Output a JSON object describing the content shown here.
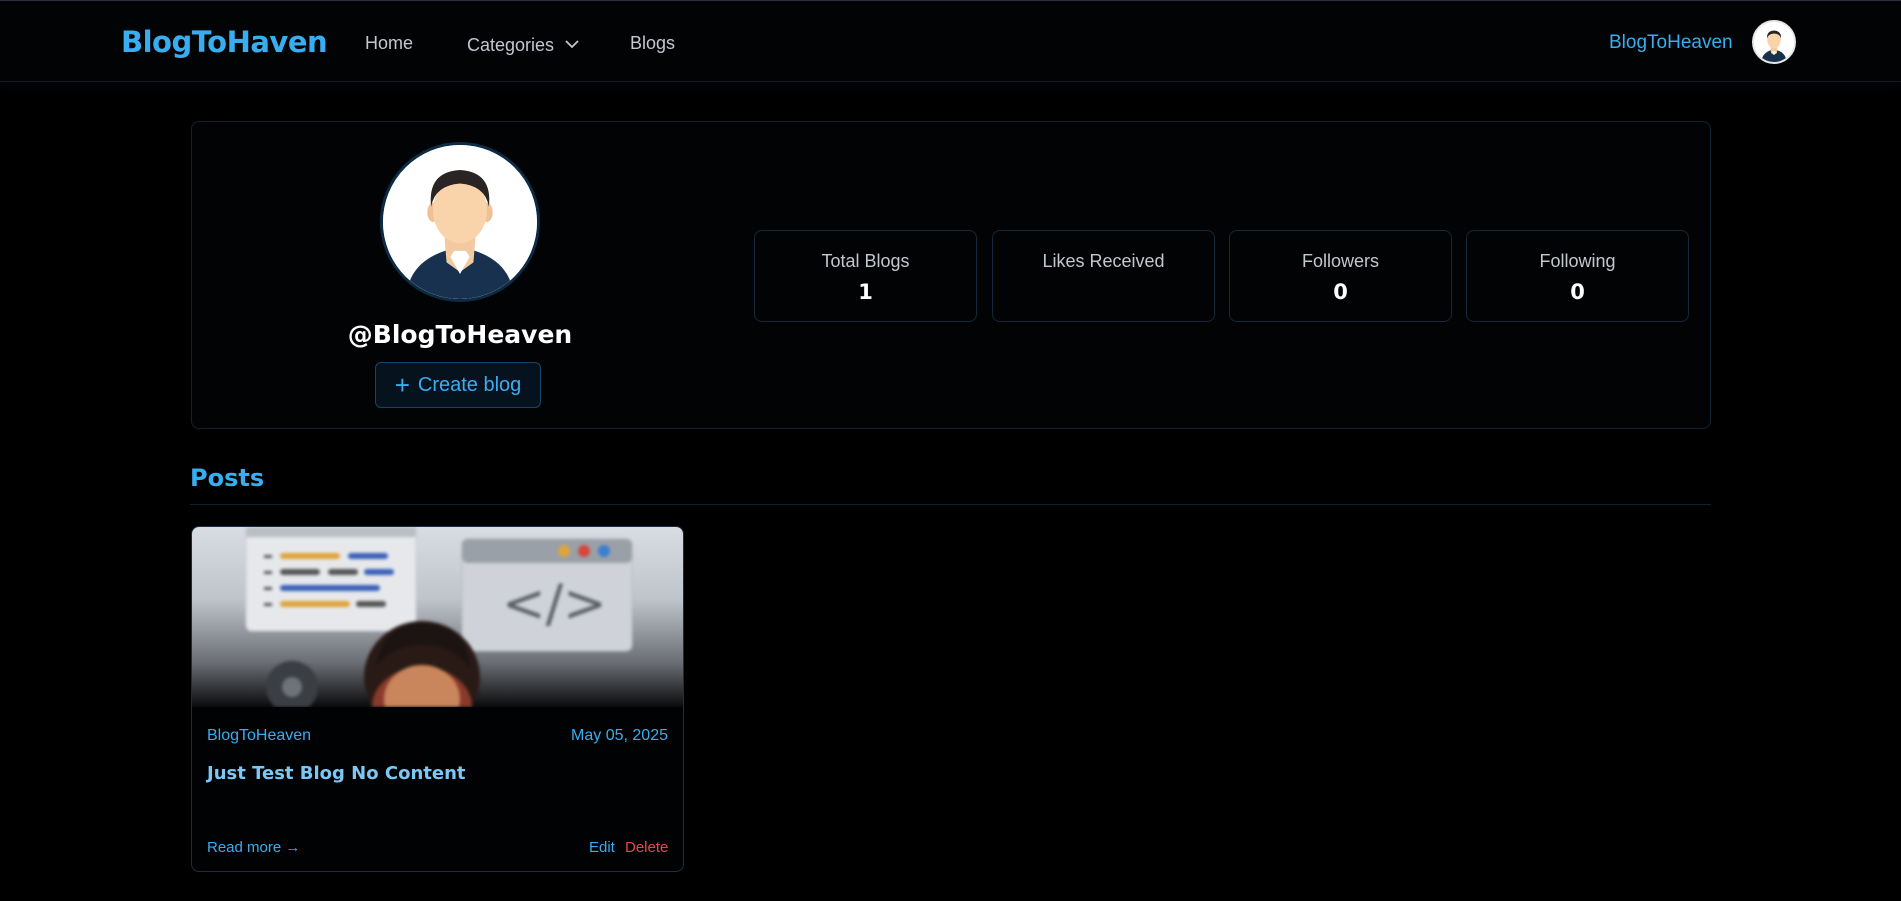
{
  "navbar": {
    "brand": "BlogToHaven",
    "links": {
      "home": "Home",
      "categories": "Categories",
      "blogs": "Blogs"
    },
    "username": "BlogToHeaven"
  },
  "profile": {
    "handle": "@BlogToHeaven",
    "create_button": "Create blog",
    "stats": [
      {
        "label": "Total Blogs",
        "value": "1"
      },
      {
        "label": "Likes Received",
        "value": ""
      },
      {
        "label": "Followers",
        "value": "0"
      },
      {
        "label": "Following",
        "value": "0"
      }
    ]
  },
  "posts": {
    "title": "Posts",
    "items": [
      {
        "author": "BlogToHeaven",
        "date": "May 05, 2025",
        "title": "Just Test Blog No Content",
        "read_more": "Read more →",
        "edit": "Edit",
        "delete": "Delete"
      }
    ]
  },
  "colors": {
    "accent": "#38aef0",
    "danger": "#ef4444",
    "background": "#000000"
  }
}
